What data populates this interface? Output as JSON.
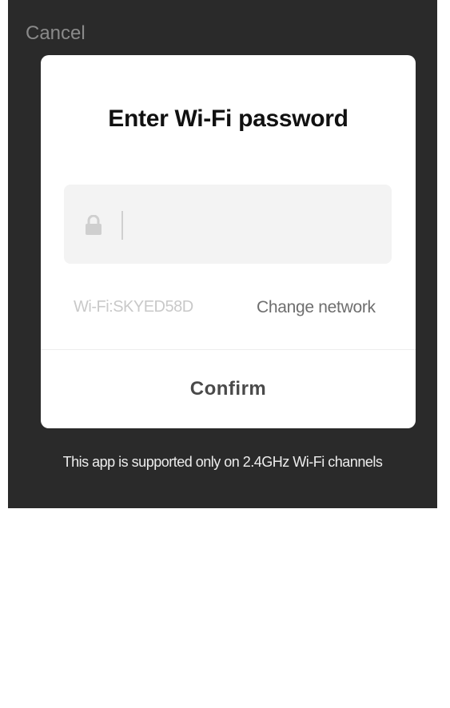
{
  "header": {
    "cancel_label": "Cancel"
  },
  "dialog": {
    "title": "Enter Wi-Fi password",
    "password_field": {
      "value": "",
      "placeholder": "",
      "icon": "lock-icon"
    },
    "network": {
      "ssid_text": "Wi-Fi:SKYED58D",
      "change_label": "Change network"
    },
    "confirm_label": "Confirm"
  },
  "footer": {
    "note": "This app is supported only on 2.4GHz Wi-Fi channels"
  },
  "colors": {
    "background": "#2a2a2a",
    "dialog": "#ffffff",
    "field": "#f3f3f3"
  }
}
